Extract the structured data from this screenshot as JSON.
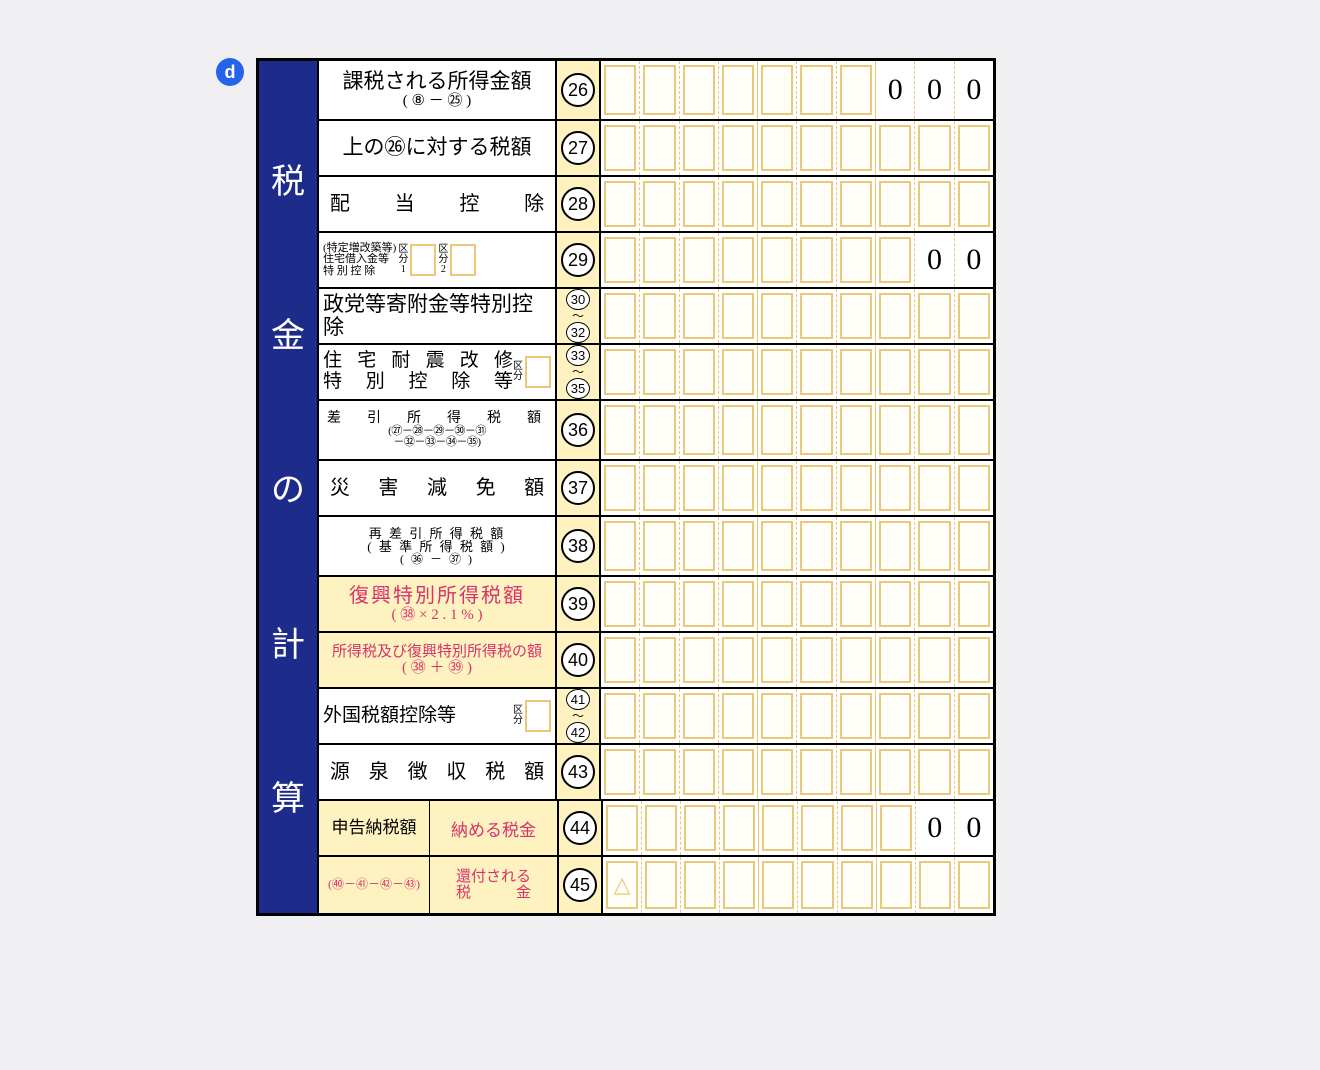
{
  "badge": "d",
  "vertical_header": [
    "税",
    "金",
    "の",
    "計",
    "算"
  ],
  "rows": [
    {
      "id": "r26",
      "label_main": "課税される所得金額",
      "label_sub": "( ⑧ － ㉕ )",
      "num": "26",
      "cells": [
        "",
        "",
        "",
        "",
        "",
        "",
        "",
        "0",
        "0",
        "0"
      ],
      "fixed_last": 3
    },
    {
      "id": "r27",
      "label_main": "上の㉖に対する税額",
      "num": "27",
      "cells": [
        "",
        "",
        "",
        "",
        "",
        "",
        "",
        "",
        "",
        ""
      ]
    },
    {
      "id": "r28",
      "label_spread": [
        "配",
        "当",
        "控",
        "除"
      ],
      "num": "28",
      "cells": [
        "",
        "",
        "",
        "",
        "",
        "",
        "",
        "",
        "",
        ""
      ]
    },
    {
      "id": "r29",
      "label_tiny_lines": [
        "(特定増改築等)",
        "住宅借入金等",
        "特 別 控 除"
      ],
      "kubun1": "区分1",
      "kubun2": "区分2",
      "num": "29",
      "cells": [
        "",
        "",
        "",
        "",
        "",
        "",
        "",
        "",
        "0",
        "0"
      ],
      "fixed_last": 2
    },
    {
      "id": "r30",
      "label_main": "政党等寄附金等特別控除",
      "num_range": [
        "30",
        "32"
      ],
      "cells": [
        "",
        "",
        "",
        "",
        "",
        "",
        "",
        "",
        "",
        ""
      ]
    },
    {
      "id": "r31",
      "label_line1_spread": [
        "住",
        "宅",
        "耐",
        "震",
        "改",
        "修"
      ],
      "label_line2_spread": [
        "特",
        "別",
        "控",
        "除",
        "等"
      ],
      "kubun": "区分",
      "num_range": [
        "33",
        "35"
      ],
      "cells": [
        "",
        "",
        "",
        "",
        "",
        "",
        "",
        "",
        "",
        ""
      ]
    },
    {
      "id": "r36",
      "label_tiny_top": "差　引　所　得　税　額",
      "label_formula1": "(㉗－㉘－㉙－㉚－㉛",
      "label_formula2": "－㉜－㉝－㉞－㉟)",
      "num": "36",
      "cells": [
        "",
        "",
        "",
        "",
        "",
        "",
        "",
        "",
        "",
        ""
      ]
    },
    {
      "id": "r37",
      "label_spread": [
        "災",
        "害",
        "減",
        "免",
        "額"
      ],
      "num": "37",
      "cells": [
        "",
        "",
        "",
        "",
        "",
        "",
        "",
        "",
        "",
        ""
      ]
    },
    {
      "id": "r38",
      "label_tiny_lines3": [
        "再 差 引 所 得 税 額",
        "( 基 準 所 得 税 額 )",
        "( ㊱ － ㊲ )"
      ],
      "num": "38",
      "cells": [
        "",
        "",
        "",
        "",
        "",
        "",
        "",
        "",
        "",
        ""
      ]
    },
    {
      "id": "r39",
      "yellow": true,
      "label_main_pink": "復興特別所得税額",
      "label_sub_pink": "( ㊳ × 2 . 1 % )",
      "num": "39",
      "cells": [
        "",
        "",
        "",
        "",
        "",
        "",
        "",
        "",
        "",
        ""
      ]
    },
    {
      "id": "r40",
      "yellow": true,
      "label_main_pink_sm": "所得税及び復興特別所得税の額",
      "label_sub_pink": "( ㊳ ＋ ㊴ )",
      "num": "40",
      "cells": [
        "",
        "",
        "",
        "",
        "",
        "",
        "",
        "",
        "",
        ""
      ]
    },
    {
      "id": "r41",
      "label_main": "外国税額控除等",
      "kubun": "区分",
      "num_range": [
        "41",
        "42"
      ],
      "cells": [
        "",
        "",
        "",
        "",
        "",
        "",
        "",
        "",
        "",
        ""
      ]
    },
    {
      "id": "r43",
      "label_spread": [
        "源",
        "泉",
        "徴",
        "収",
        "税",
        "額"
      ],
      "num": "43",
      "cells": [
        "",
        "",
        "",
        "",
        "",
        "",
        "",
        "",
        "",
        ""
      ]
    },
    {
      "id": "r44",
      "split": true,
      "left_main": "申告納税額",
      "left_sub": "",
      "right": "納める税金",
      "num": "44",
      "cells": [
        "",
        "",
        "",
        "",
        "",
        "",
        "",
        "",
        "0",
        "0"
      ],
      "fixed_last": 2
    },
    {
      "id": "r45",
      "split": true,
      "left_sub_only": "(㊵－㊶－㊷－㊸)",
      "right_lines": [
        "還付される",
        "税　　　金"
      ],
      "num": "45",
      "cells": [
        "△",
        "",
        "",
        "",
        "",
        "",
        "",
        "",
        "",
        ""
      ],
      "first_tri": true
    }
  ]
}
